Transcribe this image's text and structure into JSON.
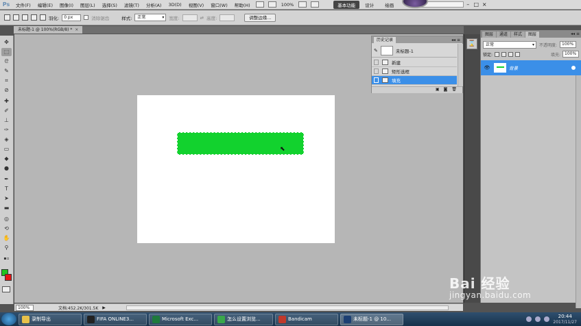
{
  "app": {
    "logo": "Ps",
    "menu": [
      "文件(F)",
      "编辑(E)",
      "图像(I)",
      "图层(L)",
      "选择(S)",
      "滤镜(T)",
      "分析(A)",
      "3D(D)",
      "视图(V)",
      "窗口(W)",
      "帮助(H)"
    ],
    "zoom": "100%",
    "workspaces": {
      "active": "基本功能",
      "design": "设计",
      "painting": "绘画"
    },
    "window_controls": {
      "minimize": "–",
      "maximize": "□",
      "close": "×"
    }
  },
  "options_bar": {
    "feather_label": "羽化:",
    "feather_value": "0 px",
    "antialias_label": "消除锯齿",
    "style_label": "样式:",
    "style_value": "正常",
    "width_label": "宽度:",
    "height_label": "高度:",
    "refine_button": "调整边缘..."
  },
  "document": {
    "tab_title": "未标题-1 @ 100%(RGB/8) *",
    "close": "×",
    "fill_color": "#12d22e",
    "foreground_color": "#1fc31f",
    "background_color": "#e61414"
  },
  "status_bar": {
    "zoom": "100%",
    "doc_info": "文档:452.2K/301.5K",
    "arrow": "▶"
  },
  "history_panel": {
    "tab": "历史记录",
    "controls": "◂◂ ≡",
    "snapshot_name": "未标题-1",
    "items": [
      {
        "label": "新建",
        "selected": false
      },
      {
        "label": "矩形选框",
        "selected": false
      },
      {
        "label": "填充",
        "selected": true
      }
    ],
    "footer_icons": [
      "▣",
      "◙",
      "🗑"
    ]
  },
  "layers_panel": {
    "tabs": [
      "图层",
      "通道",
      "样式",
      "图层"
    ],
    "controls": "◂◂ ≡",
    "blend_mode": "正常",
    "opacity_label": "不透明度:",
    "opacity_value": "100%",
    "lock_label": "锁定:",
    "fill_label": "填充:",
    "fill_value": "100%",
    "layer_name": "背景",
    "eye": "👁"
  },
  "watermark": {
    "brand": "Bai 经验",
    "url": "jingyan.baidu.com"
  },
  "taskbar": {
    "tasks": [
      {
        "label": "录制导出",
        "color": "#e8c14a"
      },
      {
        "label": "FIFA ONLINE3...",
        "color": "#222222"
      },
      {
        "label": "Microsoft Exc...",
        "color": "#1f7a3c"
      },
      {
        "label": "怎么设置浏览...",
        "color": "#3aa84b"
      },
      {
        "label": "Bandicam",
        "color": "#c0392b"
      },
      {
        "label": "未标题-1 @ 10...",
        "color": "#1c3f73"
      }
    ],
    "clock_time": "20:44",
    "clock_date": "2017/11/27"
  }
}
